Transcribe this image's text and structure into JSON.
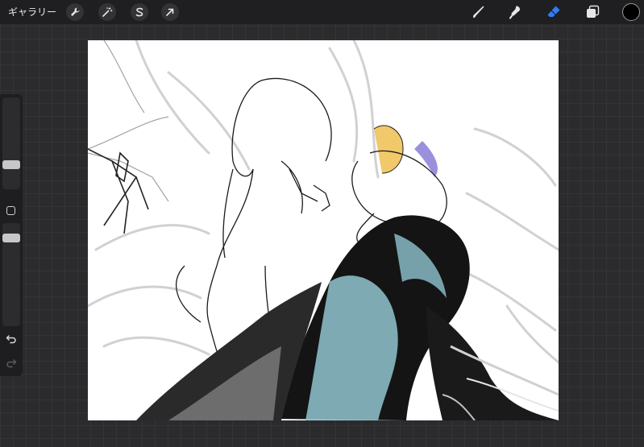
{
  "topbar": {
    "gallery_label": "ギャラリー",
    "actions": [
      {
        "name": "actions-button",
        "icon": "wrench-icon"
      },
      {
        "name": "adjustments-button",
        "icon": "magic-wand-icon"
      },
      {
        "name": "selection-button",
        "icon": "s-select-icon"
      },
      {
        "name": "transform-button",
        "icon": "arrow-cursor-icon"
      }
    ],
    "tools": [
      {
        "name": "brush-tool",
        "icon": "brush-icon"
      },
      {
        "name": "smudge-tool",
        "icon": "smudge-icon"
      },
      {
        "name": "eraser-tool",
        "icon": "eraser-icon",
        "active_color": "#2f7df6"
      },
      {
        "name": "layers-button",
        "icon": "layers-icon"
      }
    ],
    "current_color": "#000000"
  },
  "sidebar": {
    "undo_icon": "undo-icon",
    "redo_icon": "redo-icon",
    "modifier_icon": "square-modifier-icon"
  },
  "canvas": {
    "background": "#ffffff"
  }
}
